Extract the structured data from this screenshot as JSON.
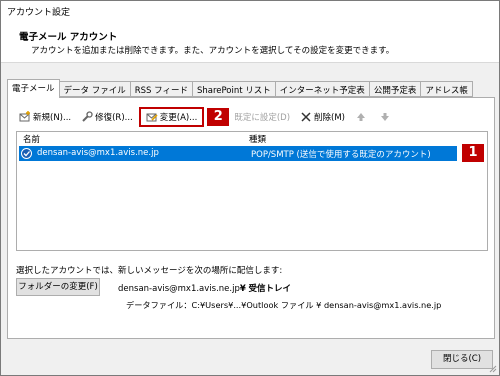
{
  "window": {
    "title": "アカウント設定"
  },
  "header": {
    "title": "電子メール アカウント",
    "description": "アカウントを追加または削除できます。また、アカウントを選択してその設定を変更できます。"
  },
  "tabs": [
    {
      "label": "電子メール",
      "active": true
    },
    {
      "label": "データ ファイル"
    },
    {
      "label": "RSS フィード"
    },
    {
      "label": "SharePoint リスト"
    },
    {
      "label": "インターネット予定表"
    },
    {
      "label": "公開予定表"
    },
    {
      "label": "アドレス帳"
    }
  ],
  "toolbar": {
    "new_label": "新規(N)...",
    "repair_label": "修復(R)...",
    "change_label": "変更(A)...",
    "default_label": "既定に設定(D)",
    "delete_label": "削除(M)",
    "callout_2": "2"
  },
  "list": {
    "col_name": "名前",
    "col_type": "種類",
    "rows": [
      {
        "name": "densan-avis@mx1.avis.ne.jp",
        "type": "POP/SMTP (送信で使用する既定のアカウント)",
        "selected": true
      }
    ],
    "callout_1": "1"
  },
  "delivery": {
    "note": "選択したアカウントでは、新しいメッセージを次の場所に配信します:",
    "folder_button": "フォルダーの変更(F)",
    "inbox_account": "densan-avis@mx1.avis.ne.jp",
    "inbox_sep": "¥",
    "inbox_folder": "受信トレイ",
    "data_file": "データファイル：C:¥Users¥...¥Outlook ファイル ¥ densan-avis@mx1.avis.ne.jp"
  },
  "footer": {
    "close_label": "閉じる(C)"
  },
  "colors": {
    "selection": "#0078d7",
    "callout": "#c00000"
  }
}
